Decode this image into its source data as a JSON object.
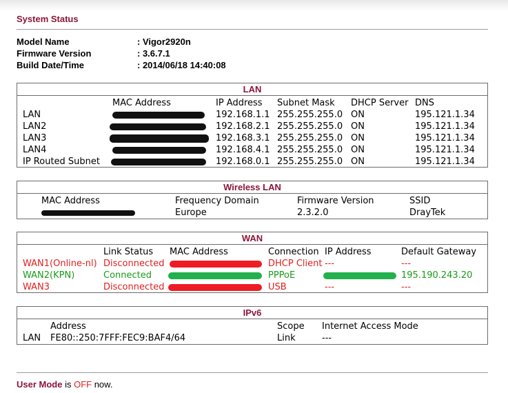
{
  "page": {
    "title": "System Status"
  },
  "system": [
    {
      "label": "Model Name",
      "value": ": Vigor2920n"
    },
    {
      "label": "Firmware Version",
      "value": ": 3.6.7.1"
    },
    {
      "label": "Build Date/Time",
      "value": ": 2014/06/18 14:40:08"
    }
  ],
  "lan": {
    "title": "LAN",
    "headers": {
      "mac": "MAC Address",
      "ip": "IP Address",
      "mask": "Subnet Mask",
      "dhcp": "DHCP Server",
      "dns": "DNS"
    },
    "rows": [
      {
        "name": "LAN",
        "ip": "192.168.1.1",
        "mask": "255.255.255.0",
        "dhcp": "ON",
        "dns": "195.121.1.34"
      },
      {
        "name": "LAN2",
        "ip": "192.168.2.1",
        "mask": "255.255.255.0",
        "dhcp": "ON",
        "dns": "195.121.1.34"
      },
      {
        "name": "LAN3",
        "ip": "192.168.3.1",
        "mask": "255.255.255.0",
        "dhcp": "ON",
        "dns": "195.121.1.34"
      },
      {
        "name": "LAN4",
        "ip": "192.168.4.1",
        "mask": "255.255.255.0",
        "dhcp": "ON",
        "dns": "195.121.1.34"
      },
      {
        "name": "IP Routed Subnet",
        "ip": "192.168.0.1",
        "mask": "255.255.255.0",
        "dhcp": "ON",
        "dns": "195.121.1.34"
      }
    ]
  },
  "wireless": {
    "title": "Wireless LAN",
    "headers": {
      "mac": "MAC Address",
      "freq": "Frequency Domain",
      "fw": "Firmware Version",
      "ssid": "SSID"
    },
    "row": {
      "freq": "Europe",
      "fw": "2.3.2.0",
      "ssid": "DrayTek"
    }
  },
  "wan": {
    "title": "WAN",
    "headers": {
      "status": "Link Status",
      "mac": "MAC Address",
      "conn": "Connection",
      "ip": "IP Address",
      "gw": "Default Gateway"
    },
    "rows": [
      {
        "name": "WAN1(Online-nl)",
        "status": "Disconnected",
        "conn": "DHCP Client",
        "ip": "---",
        "gw": "---"
      },
      {
        "name": "WAN2(KPN)",
        "status": "Connected",
        "conn": "PPPoE",
        "ip": "",
        "gw": "195.190.243.20"
      },
      {
        "name": "WAN3",
        "status": "Disconnected",
        "conn": "USB",
        "ip": "---",
        "gw": "---"
      }
    ],
    "colors": {
      "disconnected": "#e02020",
      "connected": "#1a9a1a"
    }
  },
  "ipv6": {
    "title": "IPv6",
    "headers": {
      "address": "Address",
      "scope": "Scope",
      "access": "Internet Access Mode"
    },
    "row": {
      "name": "LAN",
      "address": "FE80::250:7FFF:FEC9:BAF4/64",
      "scope": "Link",
      "access": "---"
    }
  },
  "footer": {
    "label": "User Mode",
    "is": " is ",
    "state": "OFF",
    "suffix": " now."
  }
}
